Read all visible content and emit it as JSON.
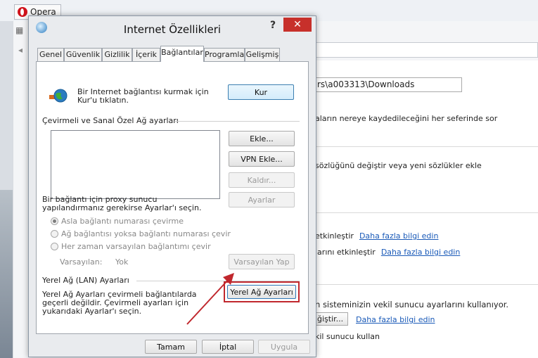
{
  "opera": {
    "app_button": "Opera",
    "download_path": "rs\\a003313\\Downloads",
    "ask_save_location": "aların nereye kaydedileceğini her seferinde sor",
    "dictionary": "sözlüğünü değiştir veya yeni sözlükler ekle",
    "enable_1": "etkinleştir",
    "enable_2": "larını etkinleştir",
    "more_info": "Daha fazla bilgi edin",
    "proxy_system": "n sisteminizin vekil sunucu ayarlarını kullanıyor.",
    "change_button": "ğiştir...",
    "proxy_use": "kil sunucu kullan"
  },
  "dialog": {
    "title": "Internet Özellikleri",
    "help": "?",
    "close": "✕",
    "tabs": [
      "Genel",
      "Güvenlik",
      "Gizlilik",
      "İçerik",
      "Bağlantılar",
      "Programlar",
      "Gelişmiş"
    ],
    "active_tab": "Bağlantılar",
    "setup_text": "Bir Internet bağlantısı kurmak için Kur'u tıklatın.",
    "setup_button": "Kur",
    "dialup_header": "Çevirmeli ve Sanal Özel Ağ ayarları",
    "add_button": "Ekle...",
    "vpn_button": "VPN Ekle...",
    "remove_button": "Kaldır...",
    "proxy_text": "Bir bağlantı için proxy sunucu yapılandırmanız gerekirse Ayarlar'ı seçin.",
    "settings_button": "Ayarlar",
    "radios": [
      {
        "label": "Asla bağlantı numarası çevirme",
        "checked": true
      },
      {
        "label": "Ağ bağlantısı yoksa bağlantı numarası çevir",
        "checked": false
      },
      {
        "label": "Her zaman varsayılan bağlantımı çevir",
        "checked": false
      }
    ],
    "default_label": "Varsayılan:",
    "default_value": "Yok",
    "set_default_button": "Varsayılan Yap",
    "lan_header": "Yerel Ağ (LAN) Ayarları",
    "lan_text": "Yerel Ağ Ayarları çevirmeli bağlantılarda geçerli değildir. Çevirmeli ayarları için yukarıdaki Ayarlar'ı seçin.",
    "lan_button": "Yerel Ağ Ayarları",
    "ok_button": "Tamam",
    "cancel_button": "İptal",
    "apply_button": "Uygula"
  },
  "colors": {
    "highlight": "#c0272d",
    "close_button": "#c7302b",
    "link": "#1a5ab8"
  }
}
